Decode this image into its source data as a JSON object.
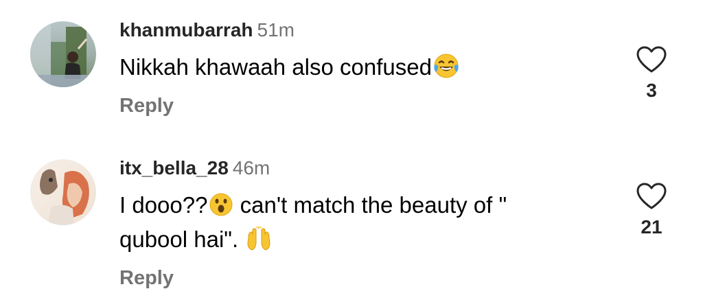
{
  "comments": [
    {
      "username": "khanmubarrah",
      "time": "51m",
      "text": "Nikkah khawaah also confused",
      "emoji_after_text": "face-with-tears-of-joy",
      "reply_label": "Reply",
      "like_count": "3"
    },
    {
      "username": "itx_bella_28",
      "time": "46m",
      "text_part1": "I dooo??",
      "emoji_mid": "face-with-open-mouth",
      "text_part2": " can't match the beauty of \"\nqubool hai\". ",
      "emoji_end": "raising-hands",
      "reply_label": "Reply",
      "like_count": "21"
    }
  ],
  "colors": {
    "username": "#262626",
    "secondary_text": "#737373",
    "comment_text": "#000000",
    "heart_outline": "#262626",
    "background": "#ffffff"
  }
}
